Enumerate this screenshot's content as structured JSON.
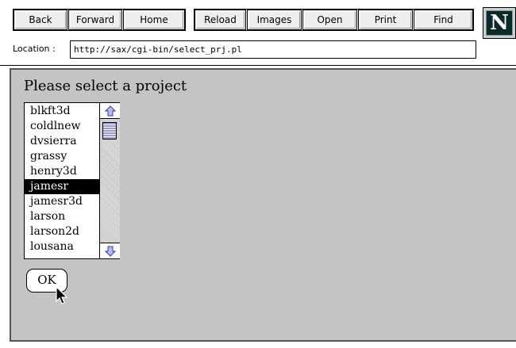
{
  "toolbar": {
    "back": "Back",
    "forward": "Forward",
    "home": "Home",
    "reload": "Reload",
    "images": "Images",
    "open": "Open",
    "print": "Print",
    "find": "Find",
    "logo_letter": "N"
  },
  "location": {
    "label": "Location :",
    "url": "http://sax/cgi-bin/select_prj.pl"
  },
  "content": {
    "prompt": "Please select a project",
    "projects": [
      "blkft3d",
      "coldlnew",
      "dvsierra",
      "grassy",
      "henry3d",
      "jamesr",
      "jamesr3d",
      "larson",
      "larson2d",
      "lousana"
    ],
    "selected_project": "jamesr",
    "ok_label": "OK"
  },
  "icons": {
    "scroll_up": "scroll-up-arrow-icon",
    "scroll_down": "scroll-down-arrow-icon",
    "cursor": "mouse-pointer-icon",
    "logo": "netscape-n-logo"
  },
  "colors": {
    "page_background": "#c4c4c4",
    "selection": "#000000",
    "scroll_arrow": "#4a4ac8"
  }
}
